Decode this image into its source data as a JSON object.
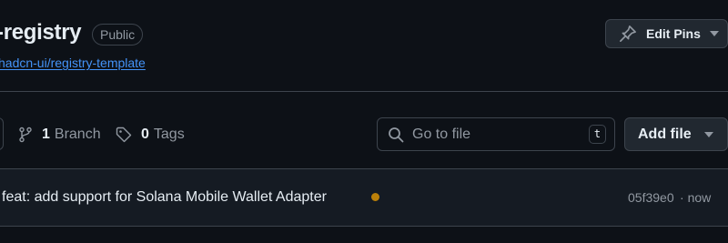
{
  "repo": {
    "name": "-registry",
    "visibility": "Public",
    "template_link": "hadcn-ui/registry-template"
  },
  "actions": {
    "edit_pins_label": "Edit Pins"
  },
  "toolbar": {
    "branch_count": "1",
    "branch_label": "Branch",
    "tag_count": "0",
    "tag_label": "Tags",
    "goto_placeholder": "Go to file",
    "goto_shortcut": "t",
    "add_file_label": "Add file"
  },
  "latest_commit": {
    "message": "feat: add support for Solana Mobile Wallet Adapter",
    "status_color": "#bb8009",
    "hash": "05f39e0",
    "separator": "·",
    "time": "now"
  },
  "icons": [
    "pin-icon",
    "chevron-down-icon",
    "git-branch-icon",
    "tag-icon",
    "search-icon"
  ],
  "colors": {
    "background": "#0d1117",
    "border": "#3d444d",
    "link": "#4493f8",
    "muted_text": "#9198a1",
    "button_bg": "#212830"
  }
}
